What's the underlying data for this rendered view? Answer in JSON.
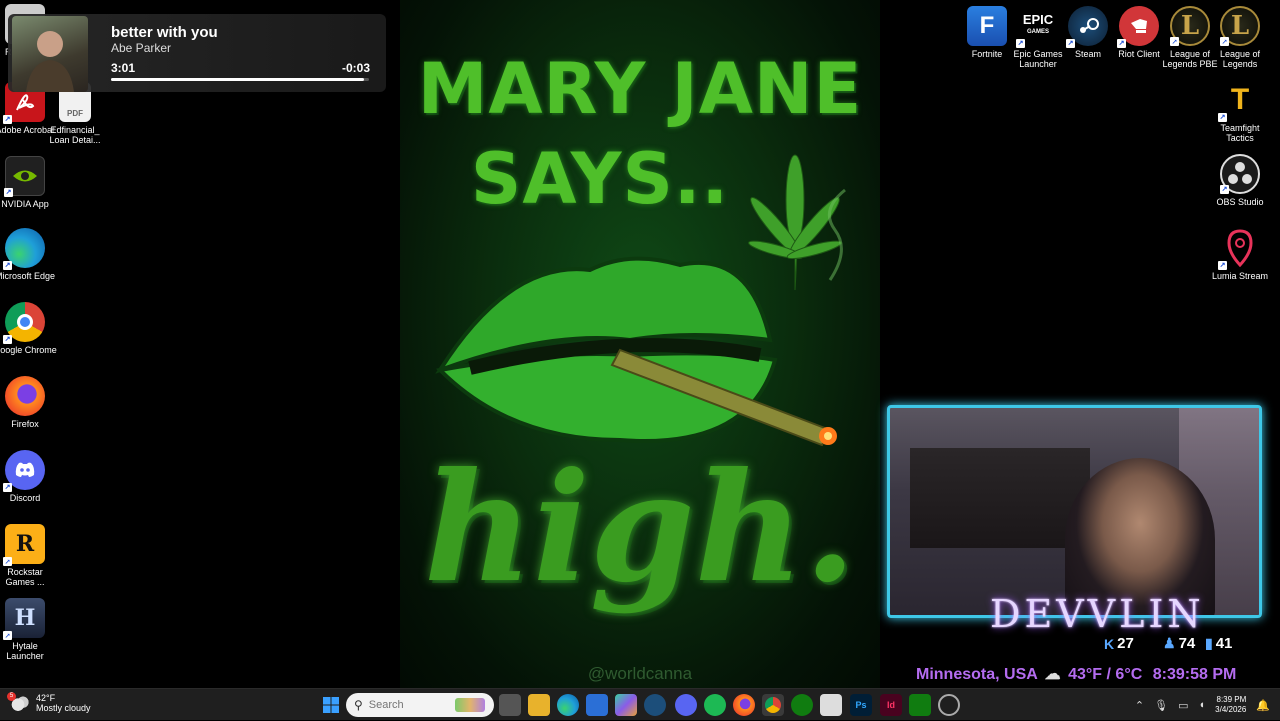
{
  "media_overlay": {
    "title": "better with you",
    "artist": "Abe Parker",
    "elapsed": "3:01",
    "remaining": "-0:03",
    "progress_fraction": 0.98
  },
  "desktop_icons_left": [
    {
      "label": "Re",
      "icon": "recycle-bin-icon"
    },
    {
      "label": "Adobe Acrobat",
      "icon": "adobe-acrobat-icon"
    },
    {
      "label": "Edfinancial_ Loan Detai...",
      "icon": "pdf-file-icon",
      "badge": "PDF"
    },
    {
      "label": "NVIDIA App",
      "icon": "nvidia-icon"
    },
    {
      "label": "Microsoft Edge",
      "icon": "edge-icon"
    },
    {
      "label": "Google Chrome",
      "icon": "chrome-icon"
    },
    {
      "label": "Firefox",
      "icon": "firefox-icon"
    },
    {
      "label": "Discord",
      "icon": "discord-icon"
    },
    {
      "label": "Rockstar Games ...",
      "icon": "rockstar-icon",
      "glyph": "R"
    },
    {
      "label": "Hytale Launcher",
      "icon": "hytale-icon",
      "glyph": "H"
    }
  ],
  "desktop_icons_right": [
    {
      "label": "Fortnite",
      "icon": "fortnite-icon",
      "glyph": "F"
    },
    {
      "label": "Epic Games Launcher",
      "icon": "epic-games-icon",
      "glyph": "EPIC",
      "sub": "GAMES"
    },
    {
      "label": "Steam",
      "icon": "steam-icon"
    },
    {
      "label": "Riot Client",
      "icon": "riot-client-icon"
    },
    {
      "label": "League of Legends PBE",
      "icon": "league-pbe-icon",
      "glyph": "L"
    },
    {
      "label": "League of Legends",
      "icon": "league-icon",
      "glyph": "L"
    },
    {
      "label": "Teamfight Tactics",
      "icon": "tft-icon",
      "glyph": "T"
    },
    {
      "label": "OBS Studio",
      "icon": "obs-icon"
    },
    {
      "label": "Lumia Stream",
      "icon": "lumia-stream-icon"
    }
  ],
  "wallpaper": {
    "line1": "MARY JANE",
    "line2": "SAYS..",
    "script": "high.",
    "credit": "@worldcanna"
  },
  "stream_overlay": {
    "name": "DEVVLIN",
    "stat_kick": "27",
    "stat_followers": "74",
    "stat_bars": "41",
    "location": "Minnesota, USA",
    "weather": "43°F / 6°C",
    "time": "8:39:58 PM"
  },
  "taskbar": {
    "weather_temp": "42°F",
    "weather_desc": "Mostly cloudy",
    "weather_badge": "5",
    "search_placeholder": "Search",
    "clock_time": "8:39 PM",
    "clock_date": "3/4/2026",
    "apps": [
      "task-view-icon",
      "file-explorer-icon",
      "edge-icon",
      "microsoft-store-icon",
      "copilot-icon",
      "steam-icon",
      "discord-icon",
      "spotify-icon",
      "firefox-icon",
      "chrome-icon",
      "xbox-icon",
      "snipping-tool-icon",
      "photoshop-icon",
      "indesign-icon",
      "xbox-app-icon",
      "settings-icon"
    ]
  },
  "colors": {
    "wallpaper_green": "#4fbf2a",
    "cam_border": "#3ec8e8",
    "overlay_purple": "#b46cf0",
    "taskbar_bg": "#1f1f1f"
  }
}
